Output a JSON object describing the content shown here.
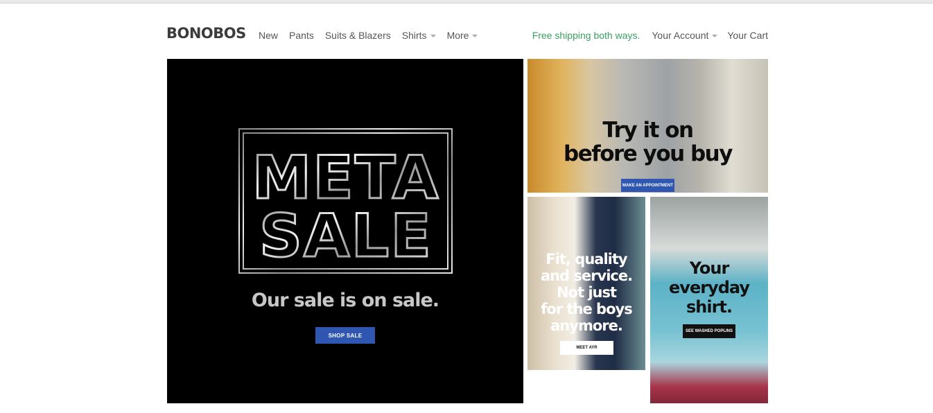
{
  "header": {
    "logo": "BONOBOS",
    "nav": [
      {
        "label": "New",
        "has_caret": false
      },
      {
        "label": "Pants",
        "has_caret": false
      },
      {
        "label": "Suits & Blazers",
        "has_caret": false
      },
      {
        "label": "Shirts",
        "has_caret": true
      },
      {
        "label": "More",
        "has_caret": true
      }
    ],
    "free_shipping": "Free shipping both ways.",
    "account": "Your Account",
    "cart": "Your Cart"
  },
  "hero": {
    "logo_line1": "META",
    "logo_line2": "SALE",
    "tagline": "Our sale is on sale.",
    "button": "SHOP SALE"
  },
  "promo_try": {
    "headline_line1": "Try it on",
    "headline_line2": "before you buy",
    "button": "MAKE AN APPOINTMENT"
  },
  "promo_fit": {
    "headline_lines": [
      "Fit, quality",
      "and service.",
      "Not just",
      "for the boys",
      "anymore."
    ],
    "button": "MEET AYR"
  },
  "promo_shirt": {
    "headline_lines": [
      "Your",
      "everyday",
      "shirt."
    ],
    "button": "SEE WASHED POPLINS"
  },
  "colors": {
    "accent_blue": "#2f56b0",
    "free_shipping_green": "#3aa060",
    "hero_bg": "#000000"
  }
}
